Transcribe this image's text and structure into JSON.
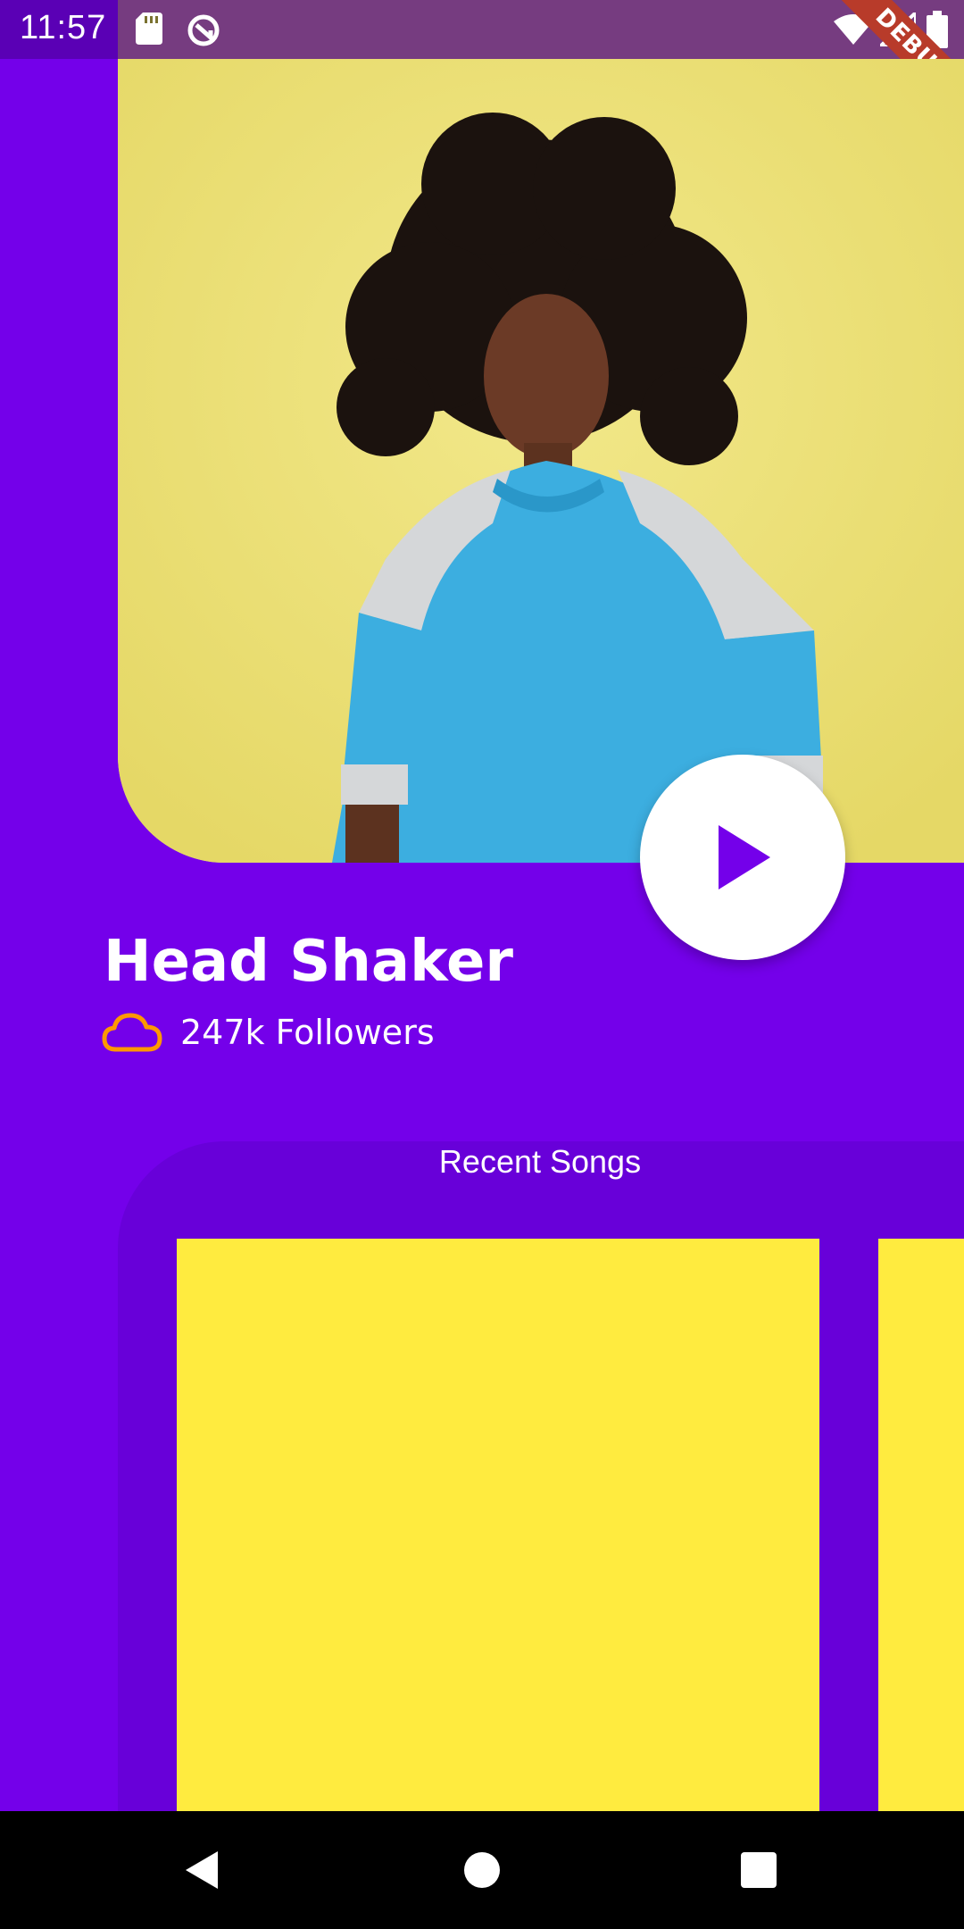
{
  "status_bar": {
    "time": "11:57",
    "icons": [
      "sd-card-icon",
      "sync-icon",
      "wifi-icon",
      "signal-icon",
      "battery-icon"
    ],
    "debug_label": "DEBUG"
  },
  "hero": {
    "image": "artist-photo"
  },
  "artist": {
    "name": "Head Shaker",
    "followers": "247k Followers"
  },
  "recent": {
    "title": "Recent Songs"
  },
  "nav": {
    "icons": [
      "back-icon",
      "home-icon",
      "recents-icon"
    ]
  },
  "colors": {
    "background": "#7400EA",
    "panel": "#6800D9",
    "card": "#FFEB3F",
    "accent": "#FF9800",
    "hero_bg": "#EEE17B"
  }
}
